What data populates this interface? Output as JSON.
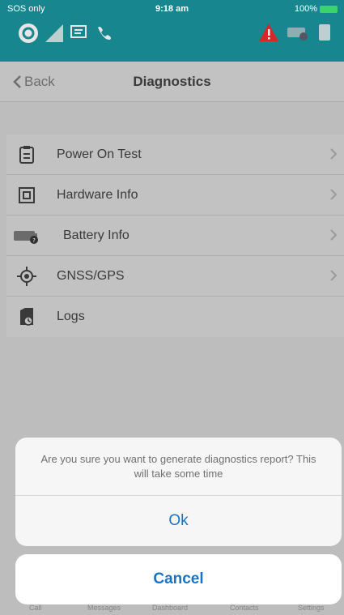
{
  "status_bar": {
    "carrier": "SOS only",
    "time": "9:18 am",
    "battery_percent": "100%"
  },
  "nav": {
    "back_label": "Back",
    "title": "Diagnostics"
  },
  "list": {
    "items": [
      {
        "label": "Power On Test",
        "icon": "clipboard-icon"
      },
      {
        "label": "Hardware Info",
        "icon": "chip-icon"
      },
      {
        "label": "Battery Info",
        "icon": "battery-icon"
      },
      {
        "label": "GNSS/GPS",
        "icon": "gps-crosshair-icon"
      },
      {
        "label": "Logs",
        "icon": "logs-icon"
      }
    ]
  },
  "alert": {
    "message": "Are you sure you want to generate diagnostics report? This will take some time",
    "ok_label": "Ok",
    "cancel_label": "Cancel"
  },
  "tabbar": {
    "items": [
      "Call",
      "Messages",
      "Dashboard",
      "Contacts",
      "Settings"
    ]
  },
  "colors": {
    "header": "#17868f",
    "accent": "#1a74c4",
    "warning": "#d62828"
  }
}
